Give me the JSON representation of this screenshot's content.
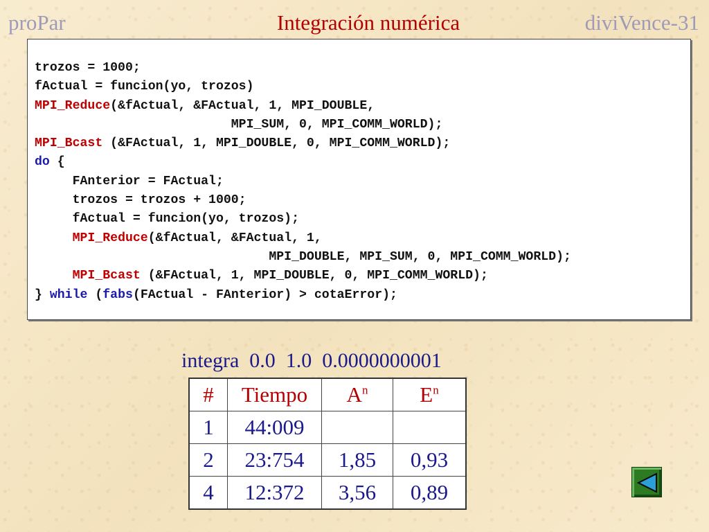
{
  "header": {
    "left": "proPar",
    "title": "Integración numérica",
    "right": "diviVence-31"
  },
  "code": {
    "l1": "trozos = 1000;",
    "l2": "fActual = funcion(yo, trozos)",
    "l3_fn": "MPI_Reduce",
    "l3_rest": "(&fActual, &FActual, 1, MPI_DOUBLE,",
    "l4": "                          MPI_SUM, 0, MPI_COMM_WORLD);",
    "l5_fn": "MPI_Bcast",
    "l5_rest": " (&FActual, 1, MPI_DOUBLE, 0, MPI_COMM_WORLD);",
    "l6_kw": "do",
    "l6_rest": " {",
    "l7": "     FAnterior = FActual;",
    "l8": "     trozos = trozos + 1000;",
    "l9": "     fActual = funcion(yo, trozos);",
    "l10_indent": "     ",
    "l10_fn": "MPI_Reduce",
    "l10_rest": "(&fActual, &FActual, 1,",
    "l11": "                               MPI_DOUBLE, MPI_SUM, 0, MPI_COMM_WORLD);",
    "l12_indent": "     ",
    "l12_fn": "MPI_Bcast",
    "l12_rest": " (&FActual, 1, MPI_DOUBLE, 0, MPI_COMM_WORLD);",
    "l13_a": "} ",
    "l13_kw": "while",
    "l13_b": " (",
    "l13_fn": "fabs",
    "l13_c": "(FActual - FAnterior) > cotaError);"
  },
  "command": "integra  0.0  1.0  0.0000000001",
  "table": {
    "headers": {
      "num": "#",
      "time": "Tiempo",
      "a": "A",
      "a_sup": "n",
      "e": "E",
      "e_sup": "n"
    },
    "rows": [
      {
        "n": "1",
        "time": "44:009",
        "a": "",
        "e": ""
      },
      {
        "n": "2",
        "time": "23:754",
        "a": "1,85",
        "e": "0,93"
      },
      {
        "n": "4",
        "time": "12:372",
        "a": "3,56",
        "e": "0,89"
      }
    ]
  },
  "nav": {
    "icon": "back-triangle-icon",
    "color": "#2c7a22"
  }
}
